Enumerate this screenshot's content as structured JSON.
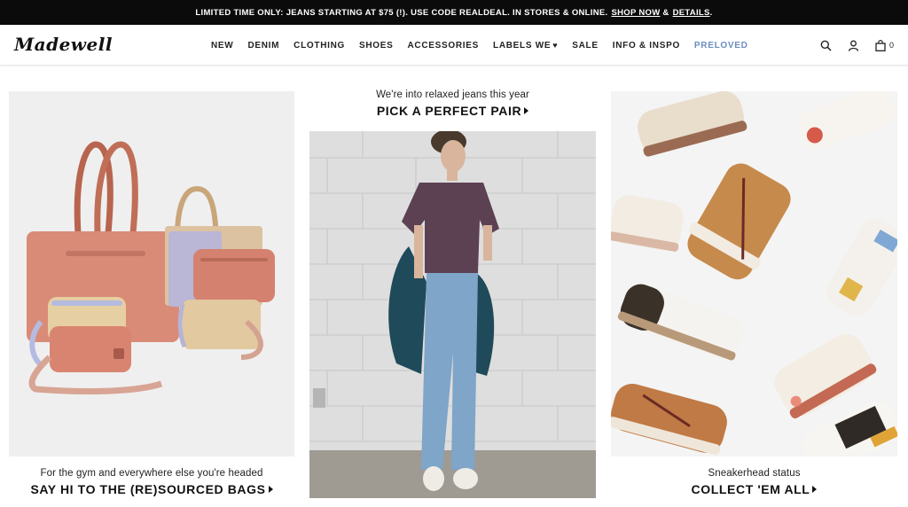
{
  "promo": {
    "text": "LIMITED TIME ONLY: JEANS STARTING AT $75 (!). USE CODE REALDEAL. IN STORES & ONLINE.",
    "shop_now": "SHOP NOW",
    "details": "DETAILS"
  },
  "header": {
    "logo": "Madewell",
    "nav": [
      {
        "label": "NEW"
      },
      {
        "label": "DENIM"
      },
      {
        "label": "CLOTHING"
      },
      {
        "label": "SHOES"
      },
      {
        "label": "ACCESSORIES"
      },
      {
        "label": "LABELS WE"
      },
      {
        "label": "SALE"
      },
      {
        "label": "INFO & INSPO"
      },
      {
        "label": "PRELOVED"
      }
    ],
    "bag_count": "0",
    "icons": [
      "search-icon",
      "account-icon",
      "shopping-bag-icon",
      "heart-icon"
    ],
    "accent_color": "#6c8ebf"
  },
  "features": [
    {
      "subtitle": "For the gym and everywhere else you're headed",
      "cta": "SAY HI TO THE (RE)SOURCED BAGS"
    },
    {
      "subtitle": "We're into relaxed jeans this year",
      "cta": "PICK A PERFECT PAIR"
    },
    {
      "subtitle": "Sneakerhead status",
      "cta": "COLLECT 'EM ALL"
    }
  ]
}
